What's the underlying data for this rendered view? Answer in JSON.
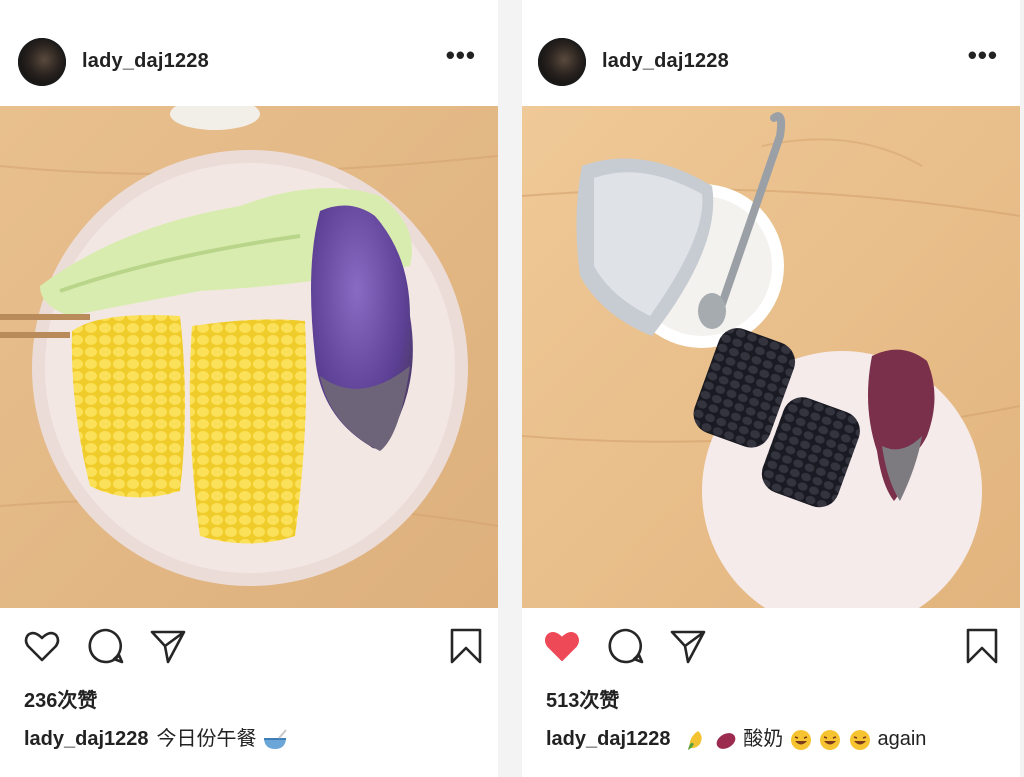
{
  "posts": [
    {
      "username": "lady_daj1228",
      "more_label": "•••",
      "liked": false,
      "likes_text": "236次赞",
      "caption_user": "lady_daj1228",
      "caption_text": "今日份午餐",
      "caption_emoji": [
        "bowl-icon"
      ]
    },
    {
      "username": "lady_daj1228",
      "more_label": "•••",
      "liked": true,
      "likes_text": "513次赞",
      "caption_user": "lady_daj1228",
      "caption_text": "酸奶",
      "caption_emoji_before": [
        "corn-icon",
        "sweet-potato-icon"
      ],
      "caption_emoji_after": [
        "laughing-face-icon",
        "laughing-face-icon",
        "laughing-face-icon"
      ],
      "caption_text_end": "again"
    }
  ],
  "colors": {
    "like_active": "#ed4956",
    "icon_stroke": "#262626",
    "wood": "#e3b783"
  }
}
